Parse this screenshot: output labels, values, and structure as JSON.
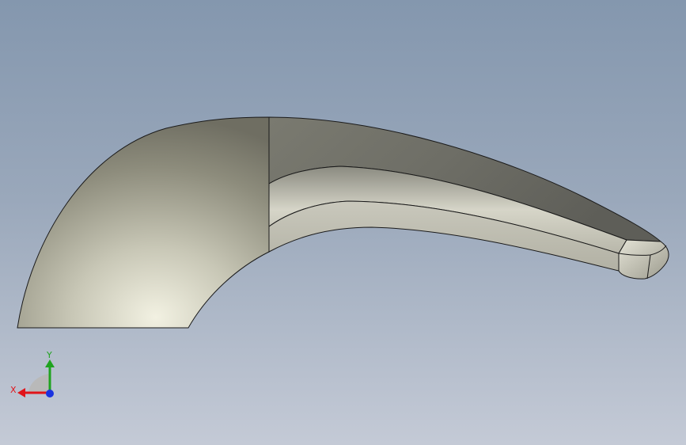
{
  "viewport": {
    "background_top": "#8497ae",
    "background_bottom": "#c4cad6"
  },
  "model": {
    "shape": "curved-swept-body",
    "face_color": "#a9a99a",
    "edge_color": "#1a1a1a"
  },
  "triad": {
    "x_label": "X",
    "y_label": "Y",
    "x_color": "#e0141a",
    "y_color": "#1fa31f",
    "z_color": "#1a33e0"
  }
}
